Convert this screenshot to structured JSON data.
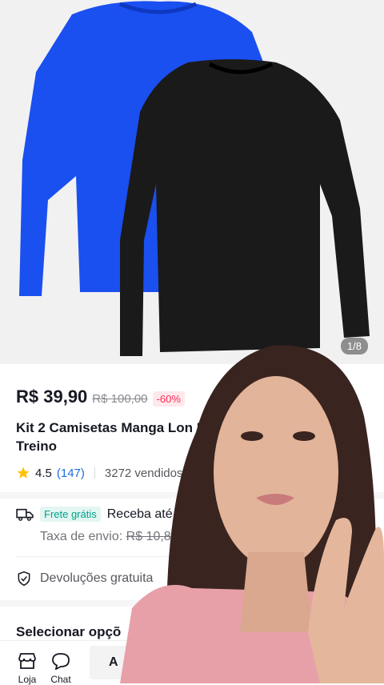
{
  "gallery": {
    "counter": "1/8"
  },
  "product": {
    "price": "R$ 39,90",
    "original_price": "R$ 100,00",
    "discount": "-60%",
    "title": "Kit 2 Camisetas Manga Lon Lisa Treino",
    "rating": "4.5",
    "reviews": "(147)",
    "sold": "3272 vendidos"
  },
  "shipping": {
    "free_badge": "Frete grátis",
    "receive": "Receba até 17",
    "fee_label": "Taxa de envio:",
    "fee_value": "R$ 10,80"
  },
  "returns": {
    "label": "Devoluções gratuita"
  },
  "options": {
    "label": "Selecionar opçõ"
  },
  "bottom_bar": {
    "shop": "Loja",
    "chat": "Chat",
    "add_cart": "A"
  },
  "colors": {
    "blue_shirt": "#1a4ff0",
    "black_shirt": "#1a1a1a",
    "discount": "#fe2c55",
    "free_shipping": "#00a08a",
    "link": "#1c6edf"
  }
}
